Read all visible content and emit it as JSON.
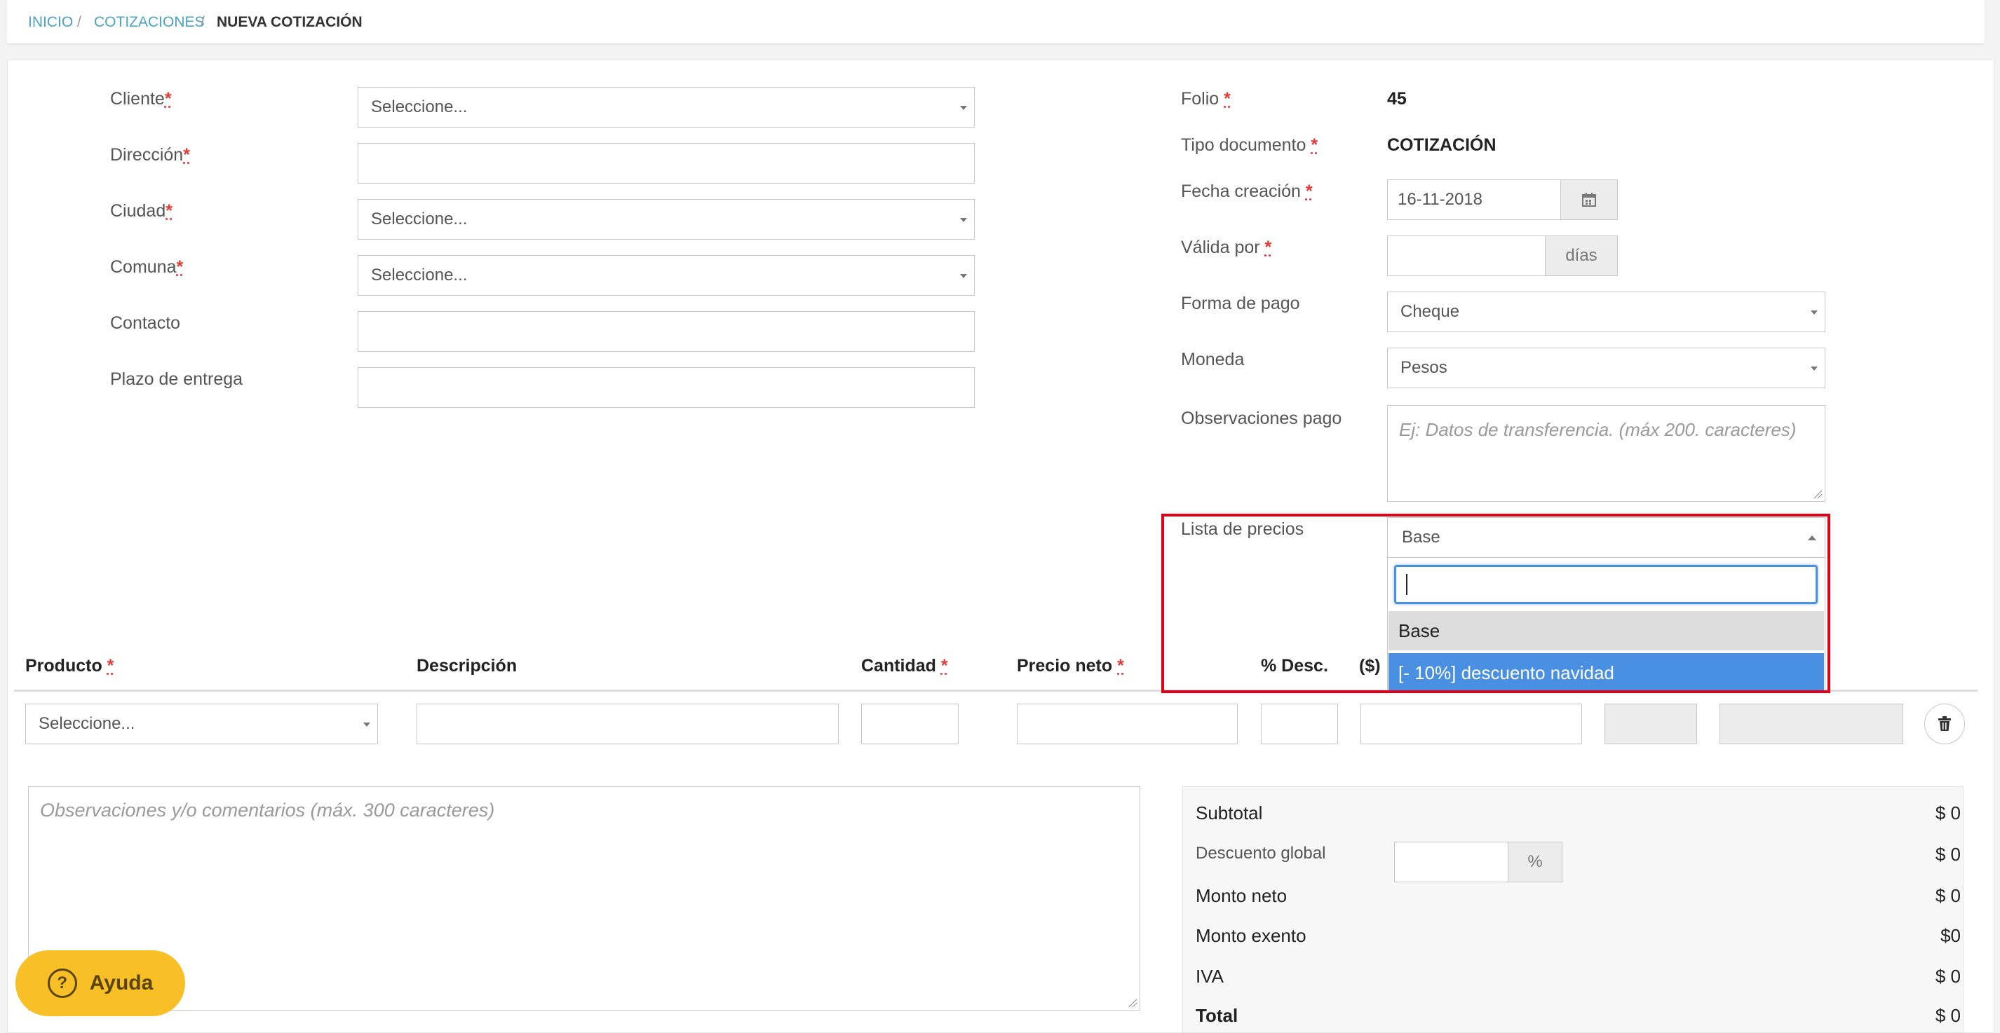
{
  "breadcrumb": {
    "home": "INICIO",
    "sep": "/",
    "quotes": "COTIZACIONES",
    "current": "NUEVA COTIZACIÓN"
  },
  "client": {
    "cliente_label": "Cliente",
    "direccion_label": "Dirección",
    "ciudad_label": "Ciudad",
    "comuna_label": "Comuna",
    "contacto_label": "Contacto",
    "plazo_label": "Plazo de entrega",
    "select_placeholder": "Seleccione...",
    "required_mark": "*"
  },
  "doc": {
    "folio_label": "Folio",
    "folio_value": "45",
    "tipo_label": "Tipo documento",
    "tipo_value": "COTIZACIÓN",
    "fecha_label": "Fecha creación",
    "fecha_value": "16-11-2018",
    "valida_label": "Válida por",
    "dias_label": "días",
    "forma_pago_label": "Forma de pago",
    "forma_pago_value": "Cheque",
    "moneda_label": "Moneda",
    "moneda_value": "Pesos",
    "obs_pago_label": "Observaciones pago",
    "obs_pago_placeholder": "Ej: Datos de transferencia. (máx 200. caracteres)",
    "lista_label": "Lista de precios",
    "lista_value": "Base",
    "dropdown_options": [
      "Base",
      "[- 10%] descuento navidad"
    ]
  },
  "table": {
    "headers": {
      "producto": "Producto",
      "descripcion": "Descripción",
      "cantidad": "Cantidad",
      "precio": "Precio neto",
      "desc": "% Desc.",
      "dollar": "($)"
    },
    "row_select_placeholder": "Seleccione..."
  },
  "comments_placeholder": "Observaciones y/o comentarios (máx. 300 caracteres)",
  "totals": {
    "subtotal_label": "Subtotal",
    "subtotal": "$ 0",
    "descuento_label": "Descuento global",
    "descuento": "$ 0",
    "pct": "%",
    "neto_label": "Monto neto",
    "neto": "$ 0",
    "exento_label": "Monto exento",
    "exento": "$0",
    "iva_label": "IVA",
    "iva": "$ 0",
    "total_label": "Total",
    "total": "$ 0"
  },
  "help": {
    "label": "Ayuda"
  },
  "colors": {
    "accent": "#4a90e2",
    "highlight": "#e0001a",
    "help": "#f8bf27",
    "link": "#4aa3c3"
  }
}
